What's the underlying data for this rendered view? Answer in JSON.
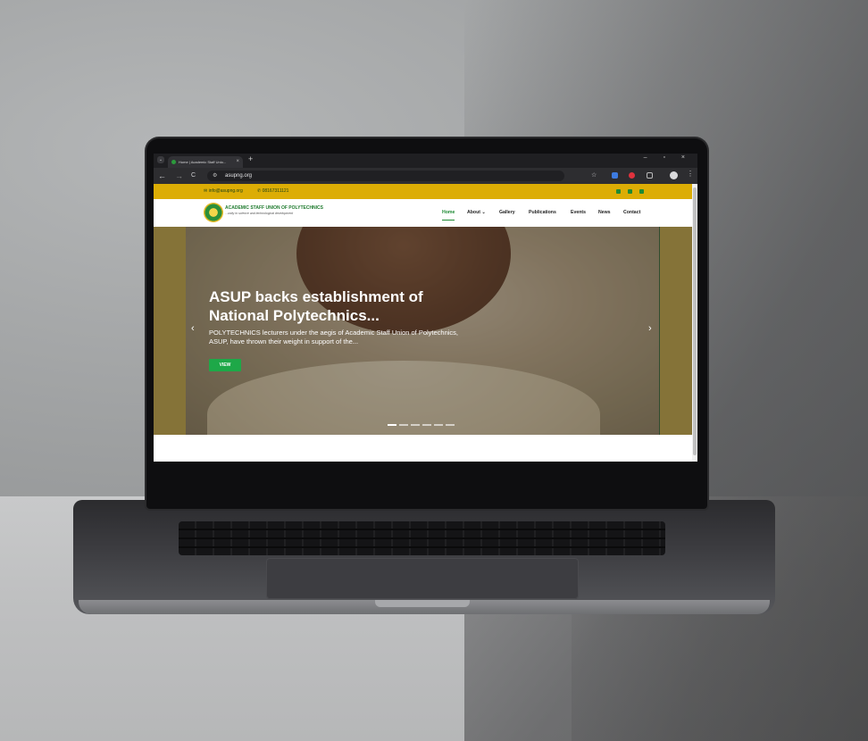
{
  "browser": {
    "tab_title": "Home | Academic Staff Unio...",
    "tab_close": "×",
    "new_tab": "+",
    "url": "asupng.org",
    "nav_back": "←",
    "nav_forward": "→",
    "nav_reload": "C",
    "bookmark_star": "☆",
    "menu": "⋮",
    "window_controls": "– ▫ ×"
  },
  "topbar": {
    "email": "info@asupng.org",
    "phone": "08167311121"
  },
  "header": {
    "logo_title": "ACADEMIC STAFF UNION OF POLYTECHNICS",
    "logo_tagline": "...unity in science and technological development",
    "nav": [
      "Home",
      "About",
      "Gallery",
      "Publications",
      "Events",
      "News",
      "Contact"
    ],
    "about_caret": "⌄"
  },
  "hero": {
    "title": "ASUP backs establishment of National Polytechnics...",
    "text": "POLYTECHNICS lecturers under the aegis of Academic Staff Union of Polytechnics, ASUP, have thrown their weight in support of the...",
    "button": "VIEW",
    "prev": "‹",
    "next": "›",
    "slide_count": 6,
    "active_slide": 1
  },
  "colors": {
    "brand_green": "#1f8a34",
    "brand_yellow": "#dcad05",
    "button_green": "#1ea848"
  }
}
